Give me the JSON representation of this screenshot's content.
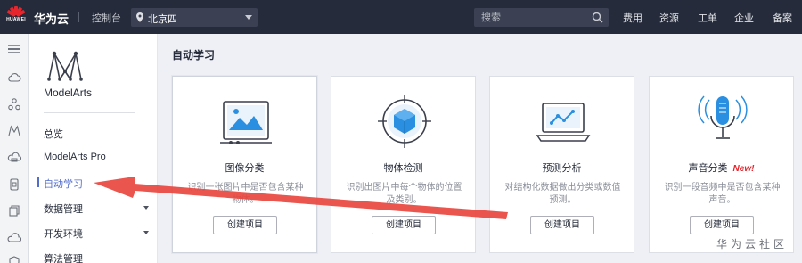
{
  "header": {
    "brand_caption": "HUAWEI",
    "brand_name": "华为云",
    "console": "控制台",
    "region": "北京四",
    "search_placeholder": "搜索",
    "nav": [
      "费用",
      "资源",
      "工单",
      "企业",
      "备案"
    ]
  },
  "menu": {
    "product": "ModelArts",
    "items": [
      {
        "label": "总览"
      },
      {
        "label": "ModelArts Pro"
      },
      {
        "label": "自动学习"
      },
      {
        "label": "数据管理"
      },
      {
        "label": "开发环境"
      },
      {
        "label": "算法管理"
      }
    ]
  },
  "main": {
    "section_title": "自动学习",
    "cards": [
      {
        "title": "图像分类",
        "desc": "识别一张图片中是否包含某种物体。",
        "button": "创建项目",
        "icon": "image-classification-icon"
      },
      {
        "title": "物体检测",
        "desc": "识别出图片中每个物体的位置及类别。",
        "button": "创建项目",
        "icon": "object-detection-icon"
      },
      {
        "title": "预测分析",
        "desc": "对结构化数据做出分类或数值预测。",
        "button": "创建项目",
        "icon": "predictive-analysis-icon"
      },
      {
        "title": "声音分类",
        "badge": "New!",
        "desc": "识别一段音频中是否包含某种声音。",
        "button": "创建项目",
        "icon": "sound-classification-icon"
      }
    ]
  },
  "watermark": "华为云社区",
  "colors": {
    "topbar": "#252b3a",
    "accent": "#526ecc",
    "brand_red": "#e6252c",
    "annotation_arrow": "#e8473f"
  }
}
